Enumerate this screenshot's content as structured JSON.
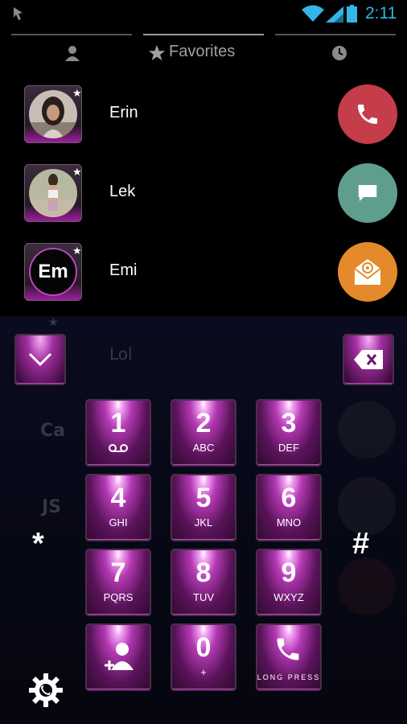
{
  "status_bar": {
    "time": "2:11"
  },
  "tabs": [
    {
      "label": "",
      "icon": "person-icon"
    },
    {
      "label": "Favorites",
      "icon": "star-icon"
    },
    {
      "label": "",
      "icon": "clock-icon"
    }
  ],
  "favorites": [
    {
      "name": "Erin",
      "avatar": "photo",
      "action": "phone-icon",
      "action_color": "#c53d4a"
    },
    {
      "name": "Lek",
      "avatar": "photo",
      "action": "message-icon",
      "action_color": "#5f9e8e"
    },
    {
      "name": "Emi",
      "initials": "Em",
      "action": "mail-icon",
      "action_color": "#e58a2b"
    }
  ],
  "background_contacts": [
    {
      "initials": "",
      "name": "Lol"
    },
    {
      "initials": "Ca",
      "name": ""
    },
    {
      "initials": "JS",
      "name": ""
    }
  ],
  "dialpad": {
    "keys": [
      {
        "num": "1",
        "letters": "voicemail-icon"
      },
      {
        "num": "2",
        "letters": "ABC"
      },
      {
        "num": "3",
        "letters": "DEF"
      },
      {
        "num": "4",
        "letters": "GHI"
      },
      {
        "num": "5",
        "letters": "JKL"
      },
      {
        "num": "6",
        "letters": "MNO"
      },
      {
        "num": "7",
        "letters": "PQRS"
      },
      {
        "num": "8",
        "letters": "TUV"
      },
      {
        "num": "9",
        "letters": "WXYZ"
      },
      {
        "num": "",
        "letters": "add-contact-icon"
      },
      {
        "num": "0",
        "letters": "+"
      },
      {
        "num": "",
        "letters": "call-icon"
      }
    ],
    "star": "*",
    "hash": "#",
    "call_key_caption": "LONG PRESS"
  },
  "colors": {
    "accent": "#b43ab4",
    "time": "#33b5e5"
  }
}
